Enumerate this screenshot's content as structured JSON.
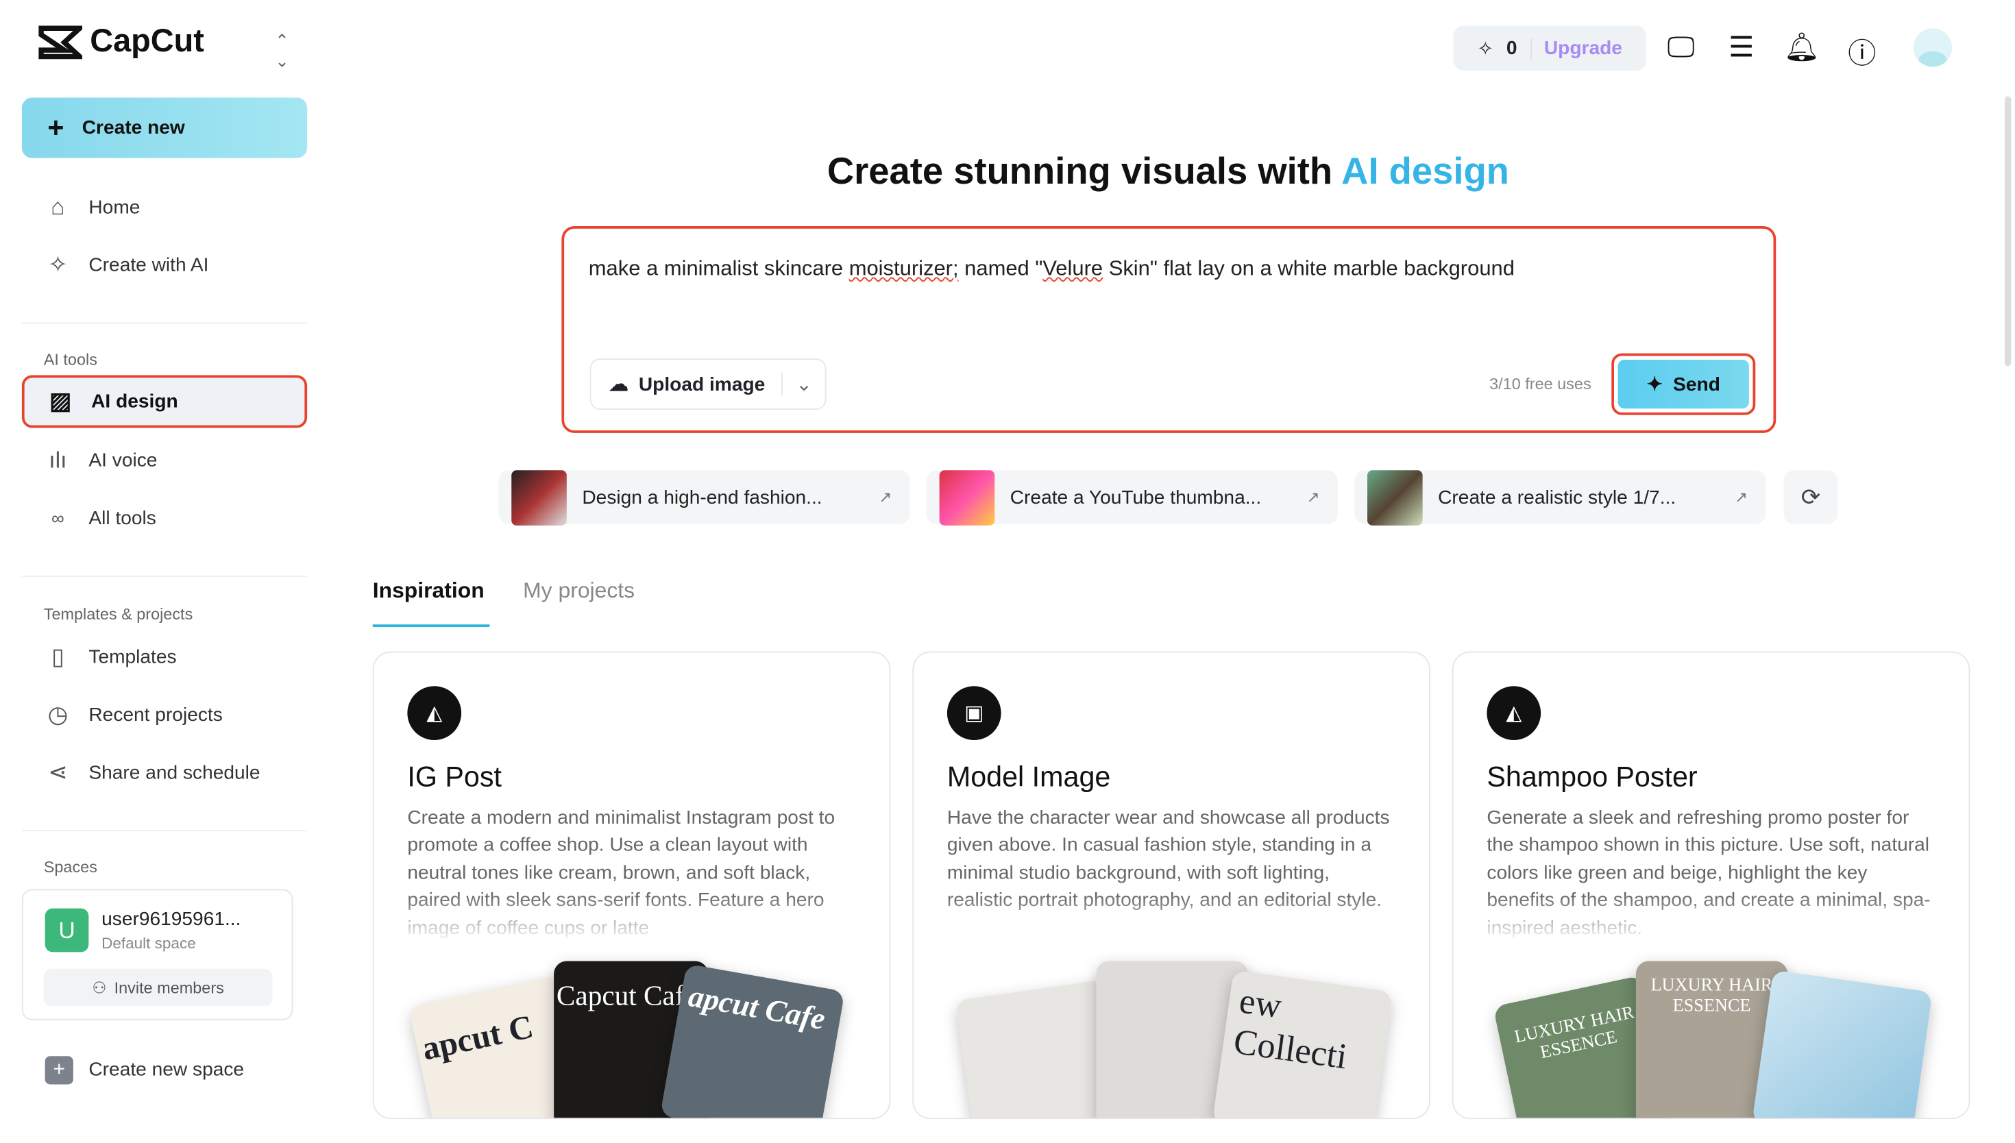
{
  "brand": {
    "name": "CapCut"
  },
  "sidebar": {
    "create_new": "Create new",
    "items": [
      {
        "label": "Home"
      },
      {
        "label": "Create with AI"
      }
    ],
    "ai_tools_label": "AI tools",
    "ai_tools": [
      {
        "label": "AI design"
      },
      {
        "label": "AI voice"
      },
      {
        "label": "All tools"
      }
    ],
    "templates_label": "Templates & projects",
    "templates": [
      {
        "label": "Templates"
      },
      {
        "label": "Recent projects"
      },
      {
        "label": "Share and schedule"
      }
    ],
    "spaces_label": "Spaces",
    "space": {
      "initial": "U",
      "name": "user96195961...",
      "type": "Default space",
      "invite": "Invite members"
    },
    "create_space": "Create new space"
  },
  "topbar": {
    "credits": "0",
    "upgrade": "Upgrade"
  },
  "hero": {
    "title_prefix": "Create stunning visuals with ",
    "title_accent": "AI design"
  },
  "prompt": {
    "t1": "make a minimalist skincare ",
    "t2": "moisturizer;",
    "t3": " named \"",
    "t4": "Velure",
    "t5": " Skin\" flat lay on a white marble background",
    "upload": "Upload image",
    "uses": "3/10 free uses",
    "send": "Send"
  },
  "suggestions": [
    {
      "label": "Design a high-end fashion..."
    },
    {
      "label": "Create a YouTube thumbna..."
    },
    {
      "label": "Create a realistic style 1/7..."
    }
  ],
  "tabs": [
    {
      "label": "Inspiration"
    },
    {
      "label": "My projects"
    }
  ],
  "cards": [
    {
      "title": "IG Post",
      "desc": "Create a modern and minimalist Instagram post to promote a coffee shop. Use a clean layout with neutral tones like cream, brown, and soft black, paired with sleek sans-serif fonts. Feature a hero image of coffee cups or latte",
      "img": [
        "apcut C",
        "Capcut Caf",
        "apcut Cafe"
      ]
    },
    {
      "title": "Model Image",
      "desc": "Have the character wear and showcase all products given above. In casual fashion style, standing in a minimal studio background, with soft lighting, realistic portrait photography, and an editorial style.",
      "img": [
        "",
        "",
        "ew Collecti"
      ]
    },
    {
      "title": "Shampoo Poster",
      "desc": "Generate a sleek and refreshing promo poster for the shampoo shown in this picture. Use soft, natural colors like green and beige, highlight the key benefits of the shampoo, and create a minimal, spa-inspired aesthetic.",
      "img": [
        "LUXURY HAIR ESSENCE",
        "LUXURY HAIR ESSENCE",
        ""
      ]
    }
  ],
  "colors": {
    "accent": "#29b6dd",
    "highlight": "#e8432e",
    "upgrade": "#a98af5"
  }
}
